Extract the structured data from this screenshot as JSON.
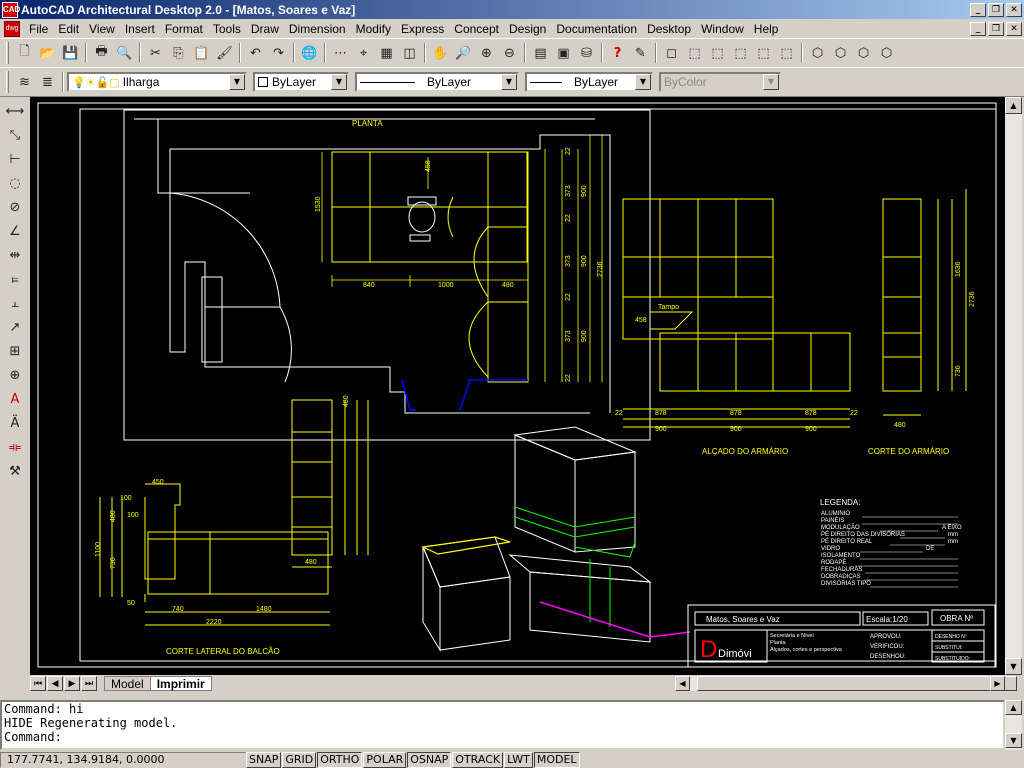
{
  "window": {
    "title": "AutoCAD Architectural Desktop 2.0 - [Matos, Soares e Vaz]",
    "icon": "autocad-icon"
  },
  "menu": [
    "File",
    "Edit",
    "View",
    "Insert",
    "Format",
    "Tools",
    "Draw",
    "Dimension",
    "Modify",
    "Express",
    "Concept",
    "Design",
    "Documentation",
    "Desktop",
    "Window",
    "Help"
  ],
  "layer_toolbar": {
    "layer": "Ilharga",
    "color": "ByLayer",
    "linetype": "ByLayer",
    "lineweight": "ByLayer",
    "plotstyle": "ByColor"
  },
  "tabs": [
    "Model",
    "Imprimir"
  ],
  "active_tab": "Imprimir",
  "command_lines": [
    "Command: hi",
    "HIDE Regenerating model.",
    "Command:"
  ],
  "status": {
    "coords": "177.7741, 134.9184, 0.0000",
    "buttons": [
      "SNAP",
      "GRID",
      "ORTHO",
      "POLAR",
      "OSNAP",
      "OTRACK",
      "LWT",
      "MODEL"
    ]
  },
  "drawing": {
    "planta_label": "PLANTA",
    "dims_plan": [
      "840",
      "1000",
      "480",
      "458",
      "1530"
    ],
    "dims_vert": [
      "22",
      "373",
      "900",
      "2736",
      "22",
      "373",
      "900",
      "22",
      "373",
      "900",
      "22"
    ],
    "tampo_label": "Tampo",
    "tampo_dim": "458",
    "alcado_label": "ALÇADO DO ARMÁRIO",
    "alcado_dims": [
      "22",
      "878",
      "878",
      "878",
      "22",
      "900",
      "900",
      "900"
    ],
    "corte_armario_label": "CORTE DO ARMÁRIO",
    "corte_dims": [
      "480",
      "1636",
      "2736",
      "736"
    ],
    "corte_balcao_label": "CORTE LATERAL DO BALCÃO",
    "balcao_dims": [
      "450",
      "100",
      "100",
      "480",
      "730",
      "1100",
      "50",
      "740",
      "1480",
      "2220",
      "480",
      "480"
    ],
    "legenda": {
      "title": "LEGENDA:",
      "items": [
        "ALUMINIO",
        "PAINÉIS",
        "MODULAÇÃO",
        "PÉ DIREITO DAS DIVISÓRIAS",
        "PÉ DIREITO REAL",
        "VIDRO",
        "ISOLAMENTO",
        "RODAPÉ",
        "FECHADURAS",
        "DOBRADIÇAS",
        "DIVISÓRIAS TIPO"
      ],
      "values": [
        "",
        "",
        "A EIXO",
        "mm",
        "mm",
        "DE",
        "",
        "",
        "",
        "",
        ""
      ]
    },
    "titleblock": {
      "client": "Matos, Soares e Vaz",
      "scale": "Escala:1/20",
      "obra": "OBRA Nº",
      "desc1": "Secretária e Nível",
      "desc2": "Planta",
      "desc3": "Alçados, cortes e perspectiva",
      "aprovou": "APROVOU:",
      "verificou": "VERIFICOU:",
      "desenhou": "DESENHOU:",
      "desenho": "DESENHO Nº",
      "substitui": "SUBSTITUI:",
      "substituido": "SUBSTITUIDO:",
      "logo": "Dimóvi"
    }
  }
}
